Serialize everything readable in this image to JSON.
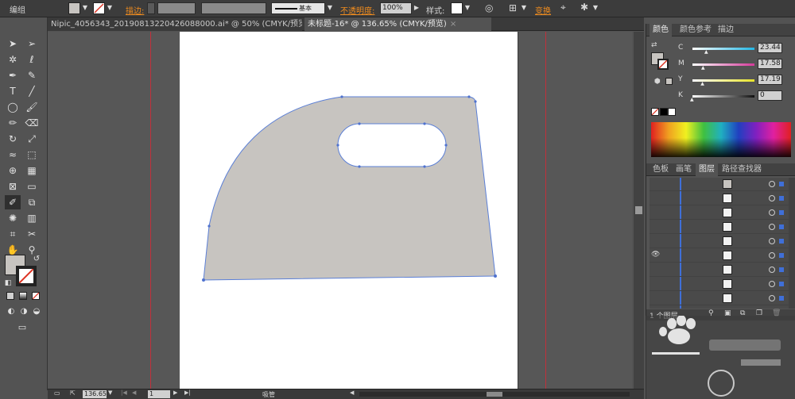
{
  "topbar": {
    "group_label": "编组",
    "stroke_label": "描边:",
    "stroke_style": "基本",
    "opacity_label": "不透明度:",
    "opacity_value": "100%",
    "style_label": "样式:",
    "transform_label": "变换"
  },
  "tabs": [
    {
      "label": "Nipic_4056343_20190813220426088000.ai* @ 50% (CMYK/预览)"
    },
    {
      "label": "未标题-16* @ 136.65% (CMYK/预览)"
    }
  ],
  "status": {
    "zoom": "136.65",
    "page": "1",
    "tool_name": "吸管"
  },
  "color_panel": {
    "tabs": [
      "颜色",
      "颜色参考",
      "描边"
    ],
    "sliders": [
      {
        "label": "C",
        "value": "23.44",
        "fraction": 0.23,
        "color": "#23b7e5"
      },
      {
        "label": "M",
        "value": "17.58",
        "fraction": 0.18,
        "color": "#d43a9a"
      },
      {
        "label": "Y",
        "value": "17.19",
        "fraction": 0.17,
        "color": "#e7e32a"
      },
      {
        "label": "K",
        "value": "0",
        "fraction": 0.0,
        "color": "#111111"
      }
    ]
  },
  "layers_panel": {
    "tabs": [
      "色板",
      "画笔",
      "图层",
      "路径查找器"
    ],
    "rows": 9,
    "footer_count": "1 个图层"
  },
  "colors": {
    "shape_fill": "#c7c4c0",
    "shape_stroke": "#5b7fd6",
    "guide": "#c0313b",
    "accent_orange": "#f08c1e"
  }
}
